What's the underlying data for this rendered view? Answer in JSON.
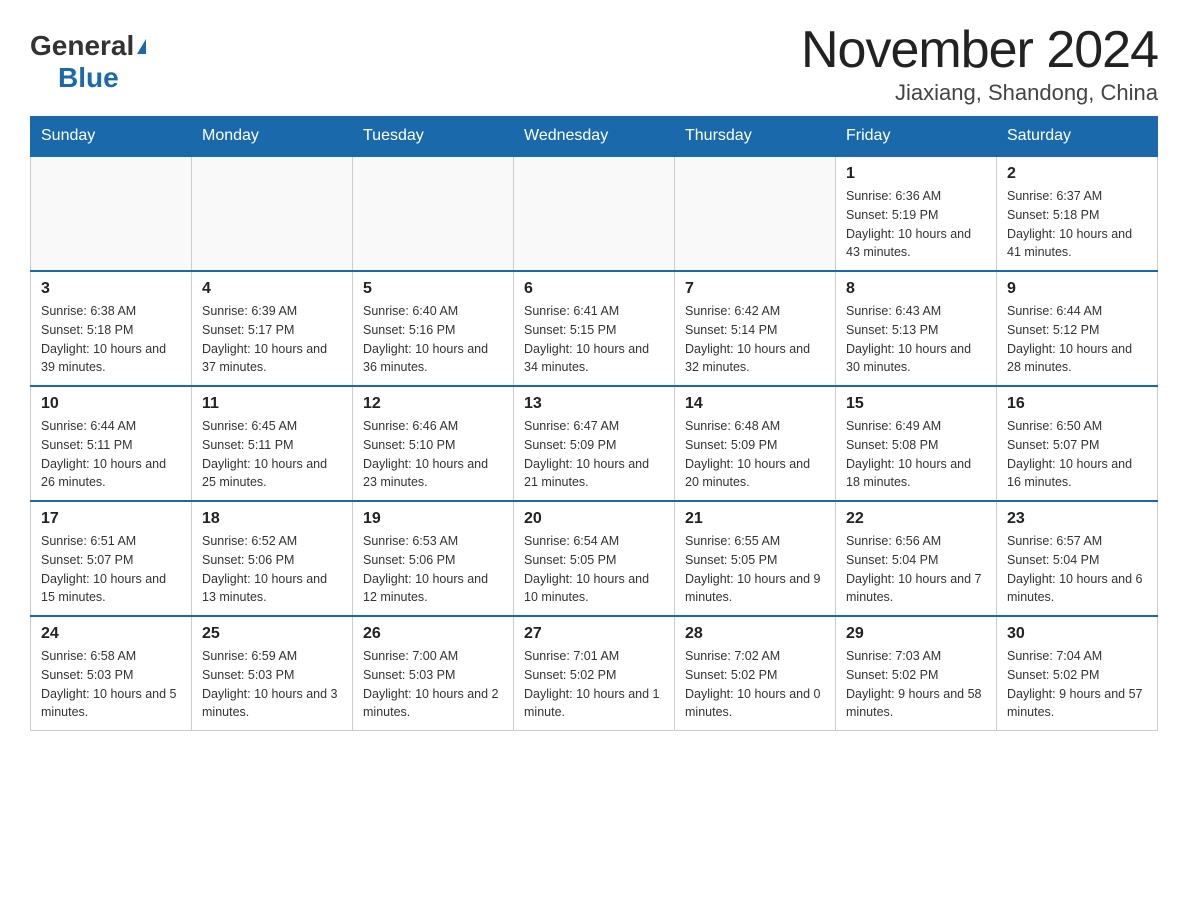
{
  "header": {
    "logo_general": "General",
    "logo_blue": "Blue",
    "title": "November 2024",
    "subtitle": "Jiaxiang, Shandong, China"
  },
  "weekdays": [
    "Sunday",
    "Monday",
    "Tuesday",
    "Wednesday",
    "Thursday",
    "Friday",
    "Saturday"
  ],
  "weeks": [
    [
      {
        "day": "",
        "info": ""
      },
      {
        "day": "",
        "info": ""
      },
      {
        "day": "",
        "info": ""
      },
      {
        "day": "",
        "info": ""
      },
      {
        "day": "",
        "info": ""
      },
      {
        "day": "1",
        "info": "Sunrise: 6:36 AM\nSunset: 5:19 PM\nDaylight: 10 hours and 43 minutes."
      },
      {
        "day": "2",
        "info": "Sunrise: 6:37 AM\nSunset: 5:18 PM\nDaylight: 10 hours and 41 minutes."
      }
    ],
    [
      {
        "day": "3",
        "info": "Sunrise: 6:38 AM\nSunset: 5:18 PM\nDaylight: 10 hours and 39 minutes."
      },
      {
        "day": "4",
        "info": "Sunrise: 6:39 AM\nSunset: 5:17 PM\nDaylight: 10 hours and 37 minutes."
      },
      {
        "day": "5",
        "info": "Sunrise: 6:40 AM\nSunset: 5:16 PM\nDaylight: 10 hours and 36 minutes."
      },
      {
        "day": "6",
        "info": "Sunrise: 6:41 AM\nSunset: 5:15 PM\nDaylight: 10 hours and 34 minutes."
      },
      {
        "day": "7",
        "info": "Sunrise: 6:42 AM\nSunset: 5:14 PM\nDaylight: 10 hours and 32 minutes."
      },
      {
        "day": "8",
        "info": "Sunrise: 6:43 AM\nSunset: 5:13 PM\nDaylight: 10 hours and 30 minutes."
      },
      {
        "day": "9",
        "info": "Sunrise: 6:44 AM\nSunset: 5:12 PM\nDaylight: 10 hours and 28 minutes."
      }
    ],
    [
      {
        "day": "10",
        "info": "Sunrise: 6:44 AM\nSunset: 5:11 PM\nDaylight: 10 hours and 26 minutes."
      },
      {
        "day": "11",
        "info": "Sunrise: 6:45 AM\nSunset: 5:11 PM\nDaylight: 10 hours and 25 minutes."
      },
      {
        "day": "12",
        "info": "Sunrise: 6:46 AM\nSunset: 5:10 PM\nDaylight: 10 hours and 23 minutes."
      },
      {
        "day": "13",
        "info": "Sunrise: 6:47 AM\nSunset: 5:09 PM\nDaylight: 10 hours and 21 minutes."
      },
      {
        "day": "14",
        "info": "Sunrise: 6:48 AM\nSunset: 5:09 PM\nDaylight: 10 hours and 20 minutes."
      },
      {
        "day": "15",
        "info": "Sunrise: 6:49 AM\nSunset: 5:08 PM\nDaylight: 10 hours and 18 minutes."
      },
      {
        "day": "16",
        "info": "Sunrise: 6:50 AM\nSunset: 5:07 PM\nDaylight: 10 hours and 16 minutes."
      }
    ],
    [
      {
        "day": "17",
        "info": "Sunrise: 6:51 AM\nSunset: 5:07 PM\nDaylight: 10 hours and 15 minutes."
      },
      {
        "day": "18",
        "info": "Sunrise: 6:52 AM\nSunset: 5:06 PM\nDaylight: 10 hours and 13 minutes."
      },
      {
        "day": "19",
        "info": "Sunrise: 6:53 AM\nSunset: 5:06 PM\nDaylight: 10 hours and 12 minutes."
      },
      {
        "day": "20",
        "info": "Sunrise: 6:54 AM\nSunset: 5:05 PM\nDaylight: 10 hours and 10 minutes."
      },
      {
        "day": "21",
        "info": "Sunrise: 6:55 AM\nSunset: 5:05 PM\nDaylight: 10 hours and 9 minutes."
      },
      {
        "day": "22",
        "info": "Sunrise: 6:56 AM\nSunset: 5:04 PM\nDaylight: 10 hours and 7 minutes."
      },
      {
        "day": "23",
        "info": "Sunrise: 6:57 AM\nSunset: 5:04 PM\nDaylight: 10 hours and 6 minutes."
      }
    ],
    [
      {
        "day": "24",
        "info": "Sunrise: 6:58 AM\nSunset: 5:03 PM\nDaylight: 10 hours and 5 minutes."
      },
      {
        "day": "25",
        "info": "Sunrise: 6:59 AM\nSunset: 5:03 PM\nDaylight: 10 hours and 3 minutes."
      },
      {
        "day": "26",
        "info": "Sunrise: 7:00 AM\nSunset: 5:03 PM\nDaylight: 10 hours and 2 minutes."
      },
      {
        "day": "27",
        "info": "Sunrise: 7:01 AM\nSunset: 5:02 PM\nDaylight: 10 hours and 1 minute."
      },
      {
        "day": "28",
        "info": "Sunrise: 7:02 AM\nSunset: 5:02 PM\nDaylight: 10 hours and 0 minutes."
      },
      {
        "day": "29",
        "info": "Sunrise: 7:03 AM\nSunset: 5:02 PM\nDaylight: 9 hours and 58 minutes."
      },
      {
        "day": "30",
        "info": "Sunrise: 7:04 AM\nSunset: 5:02 PM\nDaylight: 9 hours and 57 minutes."
      }
    ]
  ]
}
